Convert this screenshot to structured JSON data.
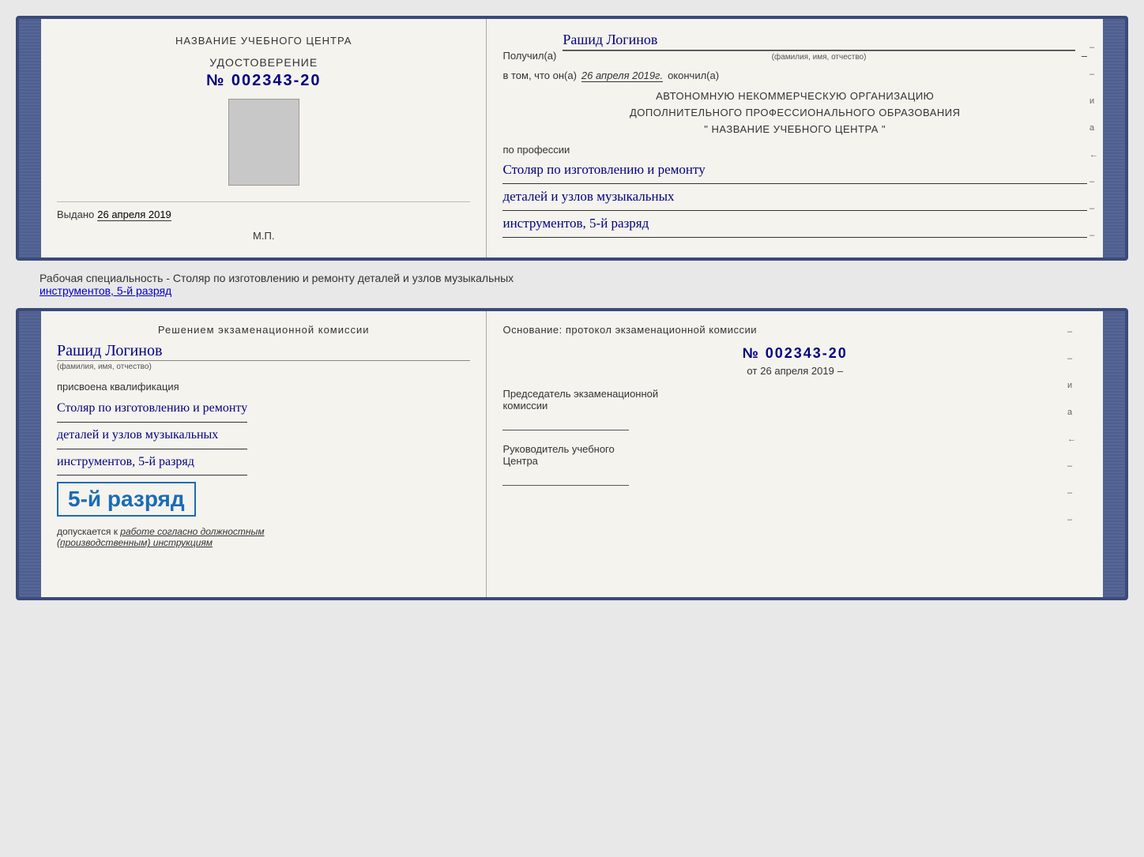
{
  "card1": {
    "left": {
      "center_label": "НАЗВАНИЕ УЧЕБНОГО ЦЕНТРА",
      "udostoverenie_title": "УДОСТОВЕРЕНИЕ",
      "udostoverenie_number": "№ 002343-20",
      "issued_prefix": "Выдано",
      "issued_date": "26 апреля 2019",
      "mp_label": "М.П."
    },
    "right": {
      "recipient_prefix": "Получил(а)",
      "recipient_name": "Рашид Логинов",
      "recipient_subtitle": "(фамилия, имя, отчество)",
      "vtom_prefix": "в том, что он(а)",
      "vtom_date": "26 апреля 2019г.",
      "vtom_suffix": "окончил(а)",
      "org_line1": "АВТОНОМНУЮ НЕКОММЕРЧЕСКУЮ ОРГАНИЗАЦИЮ",
      "org_line2": "ДОПОЛНИТЕЛЬНОГО ПРОФЕССИОНАЛЬНОГО ОБРАЗОВАНИЯ",
      "org_line3": "\"   НАЗВАНИЕ УЧЕБНОГО ЦЕНТРА   \"",
      "profession_label": "по профессии",
      "profession_line1": "Столяр по изготовлению и ремонту",
      "profession_line2": "деталей и узлов музыкальных",
      "profession_line3": "инструментов, 5-й разряд"
    }
  },
  "between": {
    "text": "Рабочая специальность - Столяр по изготовлению и ремонту деталей и узлов музыкальных",
    "text2": "инструментов, 5-й разряд"
  },
  "card2": {
    "left": {
      "decision_title": "Решением экзаменационной комиссии",
      "person_name": "Рашид Логинов",
      "person_subtitle": "(фамилия, имя, отчество)",
      "prisvoena": "присвоена квалификация",
      "qual_line1": "Столяр по изготовлению и ремонту",
      "qual_line2": "деталей и узлов музыкальных",
      "qual_line3": "инструментов, 5-й разряд",
      "razryad": "5-й разряд",
      "dopusk_prefix": "допускается к",
      "dopusk_cursive": "работе согласно должностным",
      "dopusk_cursive2": "(производственным) инструкциям"
    },
    "right": {
      "osnovaniye": "Основание: протокол экзаменационной комиссии",
      "protocol_number": "№ 002343-20",
      "ot_prefix": "от",
      "ot_date": "26 апреля 2019",
      "chairman_label1": "Председатель экзаменационной",
      "chairman_label2": "комиссии",
      "director_label1": "Руководитель учебного",
      "director_label2": "Центра"
    }
  },
  "right_marks": [
    "–",
    "–",
    "и",
    "а",
    "←",
    "–",
    "–",
    "–"
  ]
}
